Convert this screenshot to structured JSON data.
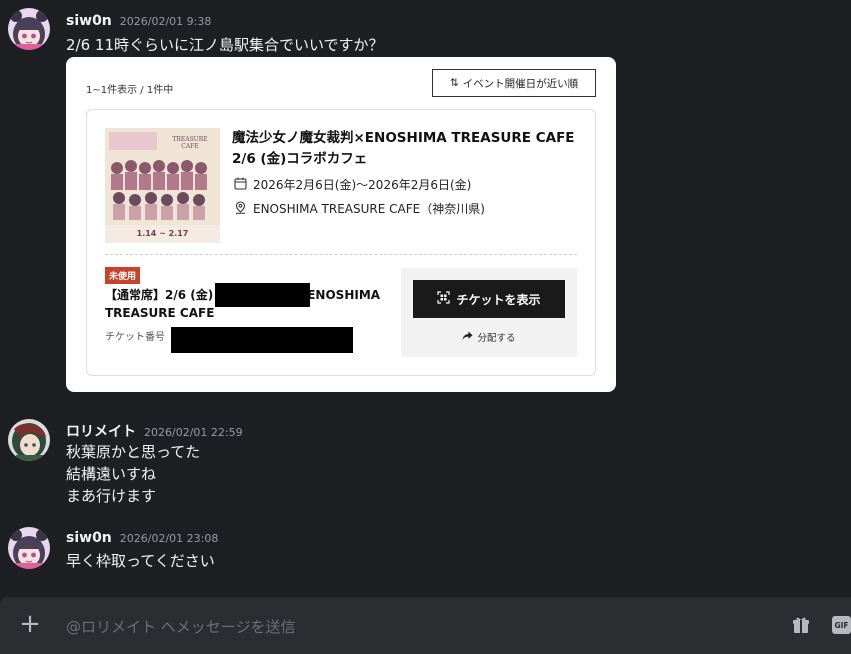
{
  "messages": [
    {
      "username": "siw0n",
      "timestamp": "2026/02/01 9:38",
      "lines": [
        "2/6 11時ぐらいに江ノ島駅集合でいいですか？"
      ]
    },
    {
      "username": "ロリメイト",
      "timestamp": "2026/02/01 22:59",
      "lines": [
        "秋葉原かと思ってた",
        "結構遠いすね",
        "まあ行けます"
      ]
    },
    {
      "username": "siw0n",
      "timestamp": "2026/02/01 23:08",
      "lines": [
        "早く枠取ってください"
      ]
    }
  ],
  "embed": {
    "result_count": "1~1件表示 / 1件中",
    "sort_label": "イベント開催日が近い順",
    "event_title": "魔法少女ノ魔女裁判×ENOSHIMA TREASURE CAFE 2/6 (金)コラボカフェ",
    "event_date": "2026年2月6日(金)〜2026年2月6日(金)",
    "event_place": "ENOSHIMA TREASURE CAFE（神奈川県)",
    "thumb_text_top": "TREASURE CAFE",
    "thumb_text_dates": "1.14 ~ 2.17",
    "status_badge": "未使用",
    "seat_prefix": "【通常席】2/6 (金)",
    "seat_suffix": "ENOSHIMA",
    "seat_line2": "TREASURE CAFE",
    "ticket_number_label": "チケット番号",
    "show_ticket_label": "チケットを表示",
    "share_label": "分配する"
  },
  "composer": {
    "placeholder": "@ロリメイト へメッセージを送信",
    "gif_label": "GIF"
  }
}
